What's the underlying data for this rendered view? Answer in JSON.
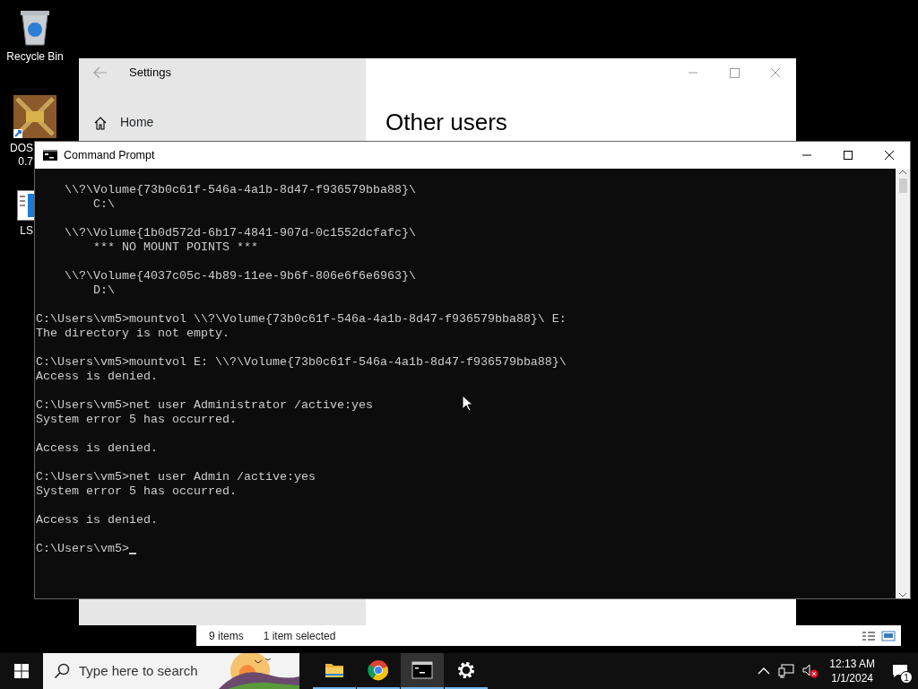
{
  "desktop_icons": [
    {
      "kind": "recycle",
      "lines": [
        "Recycle Bin"
      ]
    },
    {
      "kind": "dosbox",
      "lines": [
        "DOS",
        "0.7"
      ]
    },
    {
      "kind": "app",
      "lines": [
        "LS"
      ]
    }
  ],
  "settings_window": {
    "title": "Settings",
    "nav": [
      {
        "label": "Home"
      }
    ],
    "heading": "Other users"
  },
  "explorer_status": {
    "items": "9 items",
    "selection": "1 item selected"
  },
  "cmd_window": {
    "title": "Command Prompt",
    "blocks": [
      [
        "    \\\\?\\Volume{73b0c61f-546a-4a1b-8d47-f936579bba88}\\",
        "        C:\\"
      ],
      [
        "    \\\\?\\Volume{1b0d572d-6b17-4841-907d-0c1552dcfafc}\\",
        "        *** NO MOUNT POINTS ***"
      ],
      [
        "    \\\\?\\Volume{4037c05c-4b89-11ee-9b6f-806e6f6e6963}\\",
        "        D:\\"
      ],
      [
        "C:\\Users\\vm5>mountvol \\\\?\\Volume{73b0c61f-546a-4a1b-8d47-f936579bba88}\\ E:",
        "The directory is not empty."
      ],
      [
        "C:\\Users\\vm5>mountvol E: \\\\?\\Volume{73b0c61f-546a-4a1b-8d47-f936579bba88}\\",
        "Access is denied."
      ],
      [
        "C:\\Users\\vm5>net user Administrator /active:yes",
        "System error 5 has occurred."
      ],
      [
        "Access is denied."
      ],
      [
        "C:\\Users\\vm5>net user Admin /active:yes",
        "System error 5 has occurred."
      ],
      [
        "Access is denied."
      ]
    ],
    "prompt": "C:\\Users\\vm5>"
  },
  "taskbar": {
    "search_placeholder": "Type here to search",
    "apps": [
      {
        "kind": "folder",
        "selected": false
      },
      {
        "kind": "browser",
        "selected": false
      },
      {
        "kind": "terminal",
        "selected": true
      },
      {
        "kind": "settings",
        "selected": false
      }
    ],
    "time": "12:13 AM",
    "date": "1/1/2024",
    "notification_count": "1"
  }
}
